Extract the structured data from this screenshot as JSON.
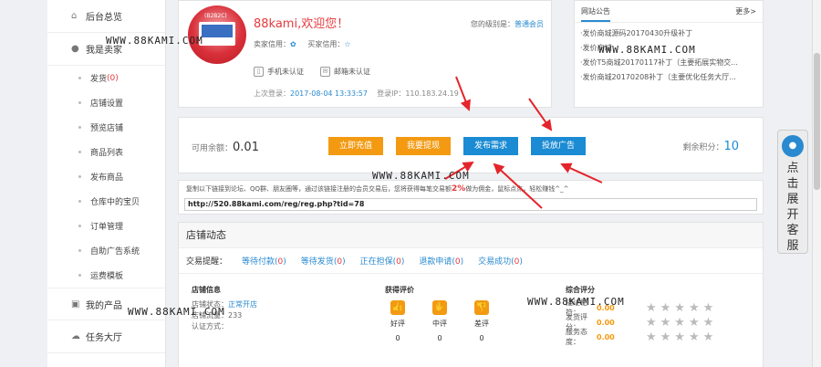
{
  "sidebar": {
    "overview": "后台总览",
    "seller": "我是卖家",
    "items": [
      {
        "label": "发货",
        "count": "(0)"
      },
      {
        "label": "店铺设置",
        "count": ""
      },
      {
        "label": "预览店铺",
        "count": ""
      },
      {
        "label": "商品列表",
        "count": ""
      },
      {
        "label": "发布商品",
        "count": ""
      },
      {
        "label": "仓库中的宝贝",
        "count": ""
      },
      {
        "label": "订单管理",
        "count": ""
      },
      {
        "label": "自助广告系统",
        "count": ""
      },
      {
        "label": "运费模板",
        "count": ""
      }
    ],
    "products": "我的产品",
    "tasks": "任务大厅"
  },
  "profile": {
    "avatar_tag": "(B2B2C)",
    "welcome": "88kami,欢迎您！",
    "level_label": "您的级别是：",
    "level": "普通会员",
    "seller_credit": "卖家信用：",
    "buyer_credit": "买家信用：",
    "phone": "手机未认证",
    "email": "邮箱未认证",
    "last_login_label": "上次登录：",
    "last_login": "2017-08-04 13:33:57",
    "ip_label": "登录IP：",
    "ip": "110.183.24.19"
  },
  "notice": {
    "tab": "网站公告",
    "more": "更多>",
    "items": [
      "·发价商城源码20170430升级补丁",
      "·发价商城",
      "·发价T5商城20170117补丁（主要拓展实物交...",
      "·发价商城20170208补丁（主要优化任务大厅..."
    ]
  },
  "balance": {
    "label": "可用余额：",
    "value": "0.01",
    "btn_recharge": "立即充值",
    "btn_withdraw": "我要提现",
    "btn_demand": "发布需求",
    "btn_ad": "投放广告",
    "points_label": "剩余积分：",
    "points": "10"
  },
  "share": {
    "text_a": "复制以下链接到论坛、QQ群、朋友圈等，通过该链接注册的会员交易后，您将获得每笔交易额",
    "pct": "2%",
    "text_b": "做为佣金，鼠标点点，轻松赚钱^_^",
    "link": "http://520.88kami.com/reg/reg.php?tid=78"
  },
  "dynamic": {
    "title": "店铺动态",
    "trade_label": "交易提醒：",
    "trades": [
      {
        "label": "等待付款",
        "n": "0"
      },
      {
        "label": "等待发货",
        "n": "0"
      },
      {
        "label": "正在担保",
        "n": "0"
      },
      {
        "label": "退款申请",
        "n": "0"
      },
      {
        "label": "交易成功",
        "n": "0"
      }
    ],
    "shop_title": "店铺信息",
    "shop_status_label": "店铺状态：",
    "shop_status": "正常开店",
    "shop_traffic_label": "店铺流量：",
    "shop_traffic": "233",
    "cert_label": "认证方式：",
    "eval_title": "获得评价",
    "evals": [
      {
        "label": "好评",
        "n": "0"
      },
      {
        "label": "中评",
        "n": "0"
      },
      {
        "label": "差评",
        "n": "0"
      }
    ],
    "score_title": "综合评分",
    "scores": [
      {
        "label": "描述相符：",
        "value": "0.00"
      },
      {
        "label": "发货评分：",
        "value": "0.00"
      },
      {
        "label": "服务态度：",
        "value": "0.00"
      }
    ]
  },
  "kefu": {
    "chars": [
      "点",
      "击",
      "展",
      "开",
      "客",
      "服"
    ]
  },
  "watermark": "WWW.88KAMI.COM"
}
